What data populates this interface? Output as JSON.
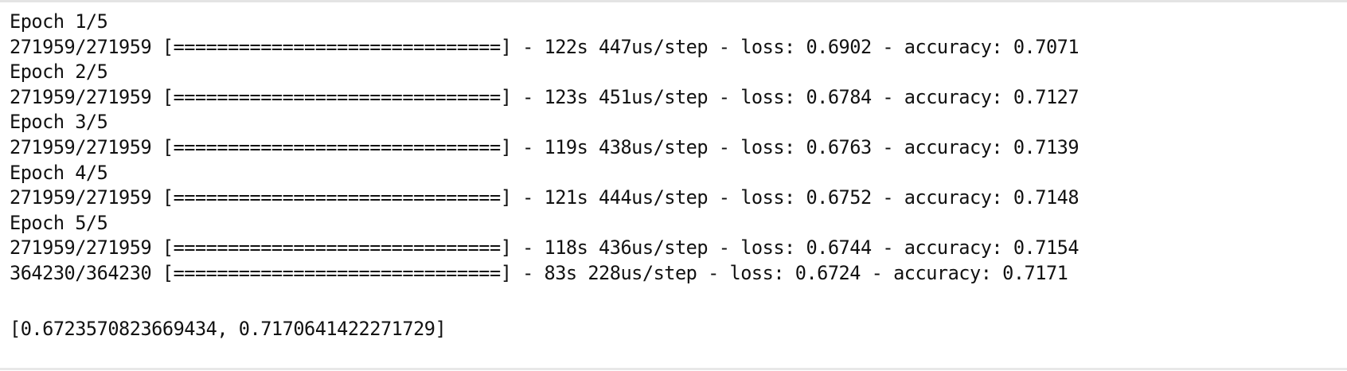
{
  "output": {
    "lines": [
      "Epoch 1/5",
      "271959/271959 [==============================] - 122s 447us/step - loss: 0.6902 - accuracy: 0.7071",
      "Epoch 2/5",
      "271959/271959 [==============================] - 123s 451us/step - loss: 0.6784 - accuracy: 0.7127",
      "Epoch 3/5",
      "271959/271959 [==============================] - 119s 438us/step - loss: 0.6763 - accuracy: 0.7139",
      "Epoch 4/5",
      "271959/271959 [==============================] - 121s 444us/step - loss: 0.6752 - accuracy: 0.7148",
      "Epoch 5/5",
      "271959/271959 [==============================] - 118s 436us/step - loss: 0.6744 - accuracy: 0.7154",
      "364230/364230 [==============================] - 83s 228us/step - loss: 0.6724 - accuracy: 0.7171"
    ],
    "result": "[0.6723570823669434, 0.7170641422271729]"
  }
}
